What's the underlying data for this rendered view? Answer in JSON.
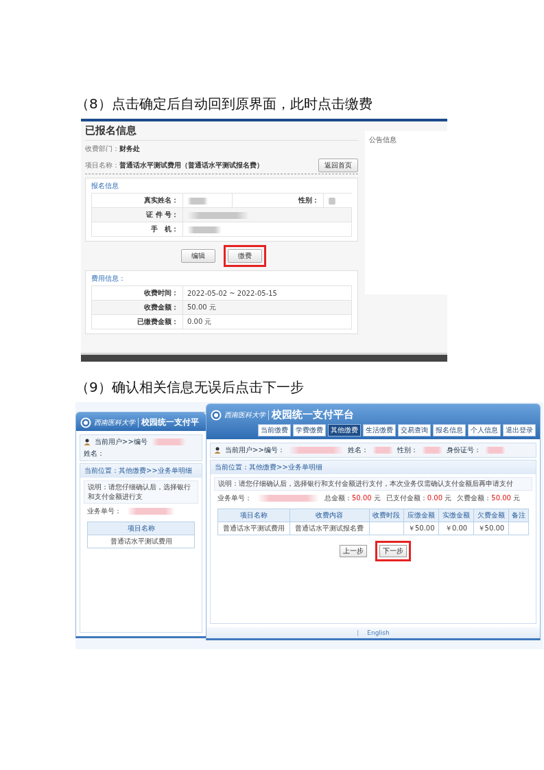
{
  "step_8": {
    "heading": "（8）点击确定后自动回到原界面，此时点击缴费",
    "screenshot": {
      "page_title": "已报名信息",
      "info_lines": [
        {
          "label": "收费部门：",
          "value": "财务处"
        },
        {
          "label": "项目名称：",
          "value": "普通话水平测试费用（普通话水平测试报名费）"
        }
      ],
      "back_button": "返回首页",
      "registration_section": {
        "title": "报名信息",
        "rows": [
          [
            {
              "label": "真实姓名："
            },
            {
              "label": "性别："
            }
          ],
          [
            {
              "label": "证 件 号："
            }
          ],
          [
            {
              "label": "手　机："
            }
          ]
        ]
      },
      "buttons": [
        {
          "label": "编辑",
          "highlighted": false
        },
        {
          "label": "缴费",
          "highlighted": true
        }
      ],
      "fee_section": {
        "title": "费用信息：",
        "rows": [
          {
            "label": "收费时间：",
            "value": "2022-05-02 ~ 2022-05-15"
          },
          {
            "label": "收费金额：",
            "value": "50.00 元"
          },
          {
            "label": "已缴费金额：",
            "value": "0.00 元"
          }
        ]
      },
      "notice_panel": {
        "title": "公告信息"
      }
    }
  },
  "step_9": {
    "heading": "（9）确认相关信息无误后点击下一步",
    "back_window": {
      "logo_text": "西南医科大学",
      "title": "校园统一支付平",
      "user_items": [
        "当前用户>>编号",
        "姓名："
      ],
      "location": "当前位置：其他缴费>>业务单明细",
      "note": "说明：请您仔细确认后，选择银行和支付金额进行支",
      "order_label": "业务单号：",
      "table": {
        "columns": [
          "项目名称"
        ],
        "rows": [
          [
            "普通话水平测试费用"
          ]
        ]
      }
    },
    "front_window": {
      "logo_text": "西南医科大学",
      "title": "校园统一支付平台",
      "nav_tabs": [
        {
          "label": "当前缴费",
          "selected": false
        },
        {
          "label": "学费缴费",
          "selected": false
        },
        {
          "label": "其他缴费",
          "selected": true
        },
        {
          "label": "生活缴费",
          "selected": false
        },
        {
          "label": "交易查询",
          "selected": false
        },
        {
          "label": "报名信息",
          "selected": false
        },
        {
          "label": "个人信息",
          "selected": false
        },
        {
          "label": "退出登录",
          "selected": false
        }
      ],
      "user_items": [
        "当前用户>>编号：",
        "姓名：",
        "性别：",
        "身份证号："
      ],
      "location": "当前位置：其他缴费>>业务单明细",
      "note": "说明：请您仔细确认后，选择银行和支付金额进行支付，本次业务仅需确认支付金额后再申请支付",
      "order_label": "业务单号：",
      "amounts": [
        {
          "label": "总金额：",
          "value": "50.00",
          "unit": "元"
        },
        {
          "label": "已支付金额：",
          "value": "0.00",
          "unit": "元"
        },
        {
          "label": "欠费金额：",
          "value": "50.00",
          "unit": "元"
        }
      ],
      "table": {
        "columns": [
          "项目名称",
          "收费内容",
          "收费时段",
          "应缴金额",
          "实缴金额",
          "欠费金额",
          "备注"
        ],
        "rows": [
          [
            "普通话水平测试费用",
            "普通话水平测试报名费",
            "",
            "￥50.00",
            "￥0.00",
            "￥50.00",
            ""
          ]
        ]
      },
      "buttons": [
        {
          "label": "上一步",
          "highlighted": false
        },
        {
          "label": "下一步",
          "highlighted": true
        }
      ],
      "footer": {
        "separator": "|",
        "link": "English"
      }
    }
  }
}
